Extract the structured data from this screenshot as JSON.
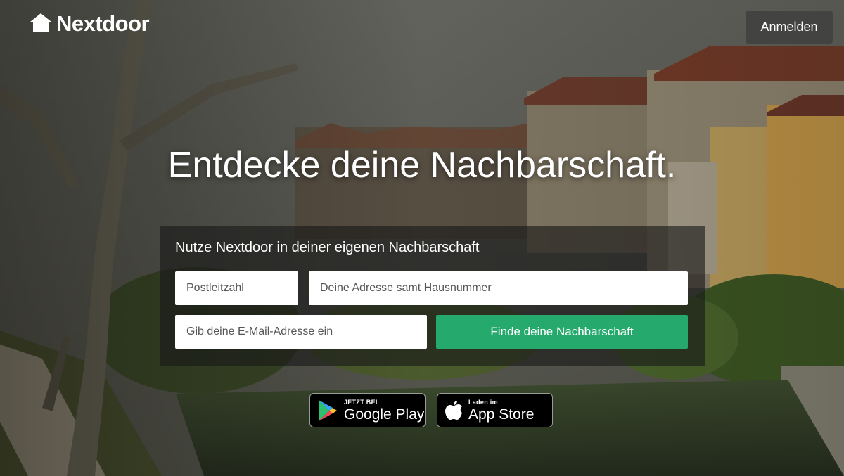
{
  "header": {
    "logo_text": "Nextdoor",
    "logo_icon": "house-icon",
    "login_label": "Anmelden"
  },
  "hero": {
    "title": "Entdecke deine Nachbarschaft."
  },
  "signup": {
    "heading": "Nutze Nextdoor in deiner eigenen Nachbarschaft",
    "zip_placeholder": "Postleitzahl",
    "address_placeholder": "Deine Adresse samt Hausnummer",
    "email_placeholder": "Gib deine E-Mail-Adresse ein",
    "submit_label": "Finde deine Nachbarschaft"
  },
  "app_badges": {
    "google_play": {
      "small": "JETZT BEI",
      "big": "Google Play",
      "icon": "google-play-icon"
    },
    "app_store": {
      "small": "Laden im",
      "big": "App Store",
      "icon": "apple-icon"
    }
  },
  "colors": {
    "accent_green": "#26a96c",
    "login_button": "#404040",
    "overlay": "#191919"
  }
}
